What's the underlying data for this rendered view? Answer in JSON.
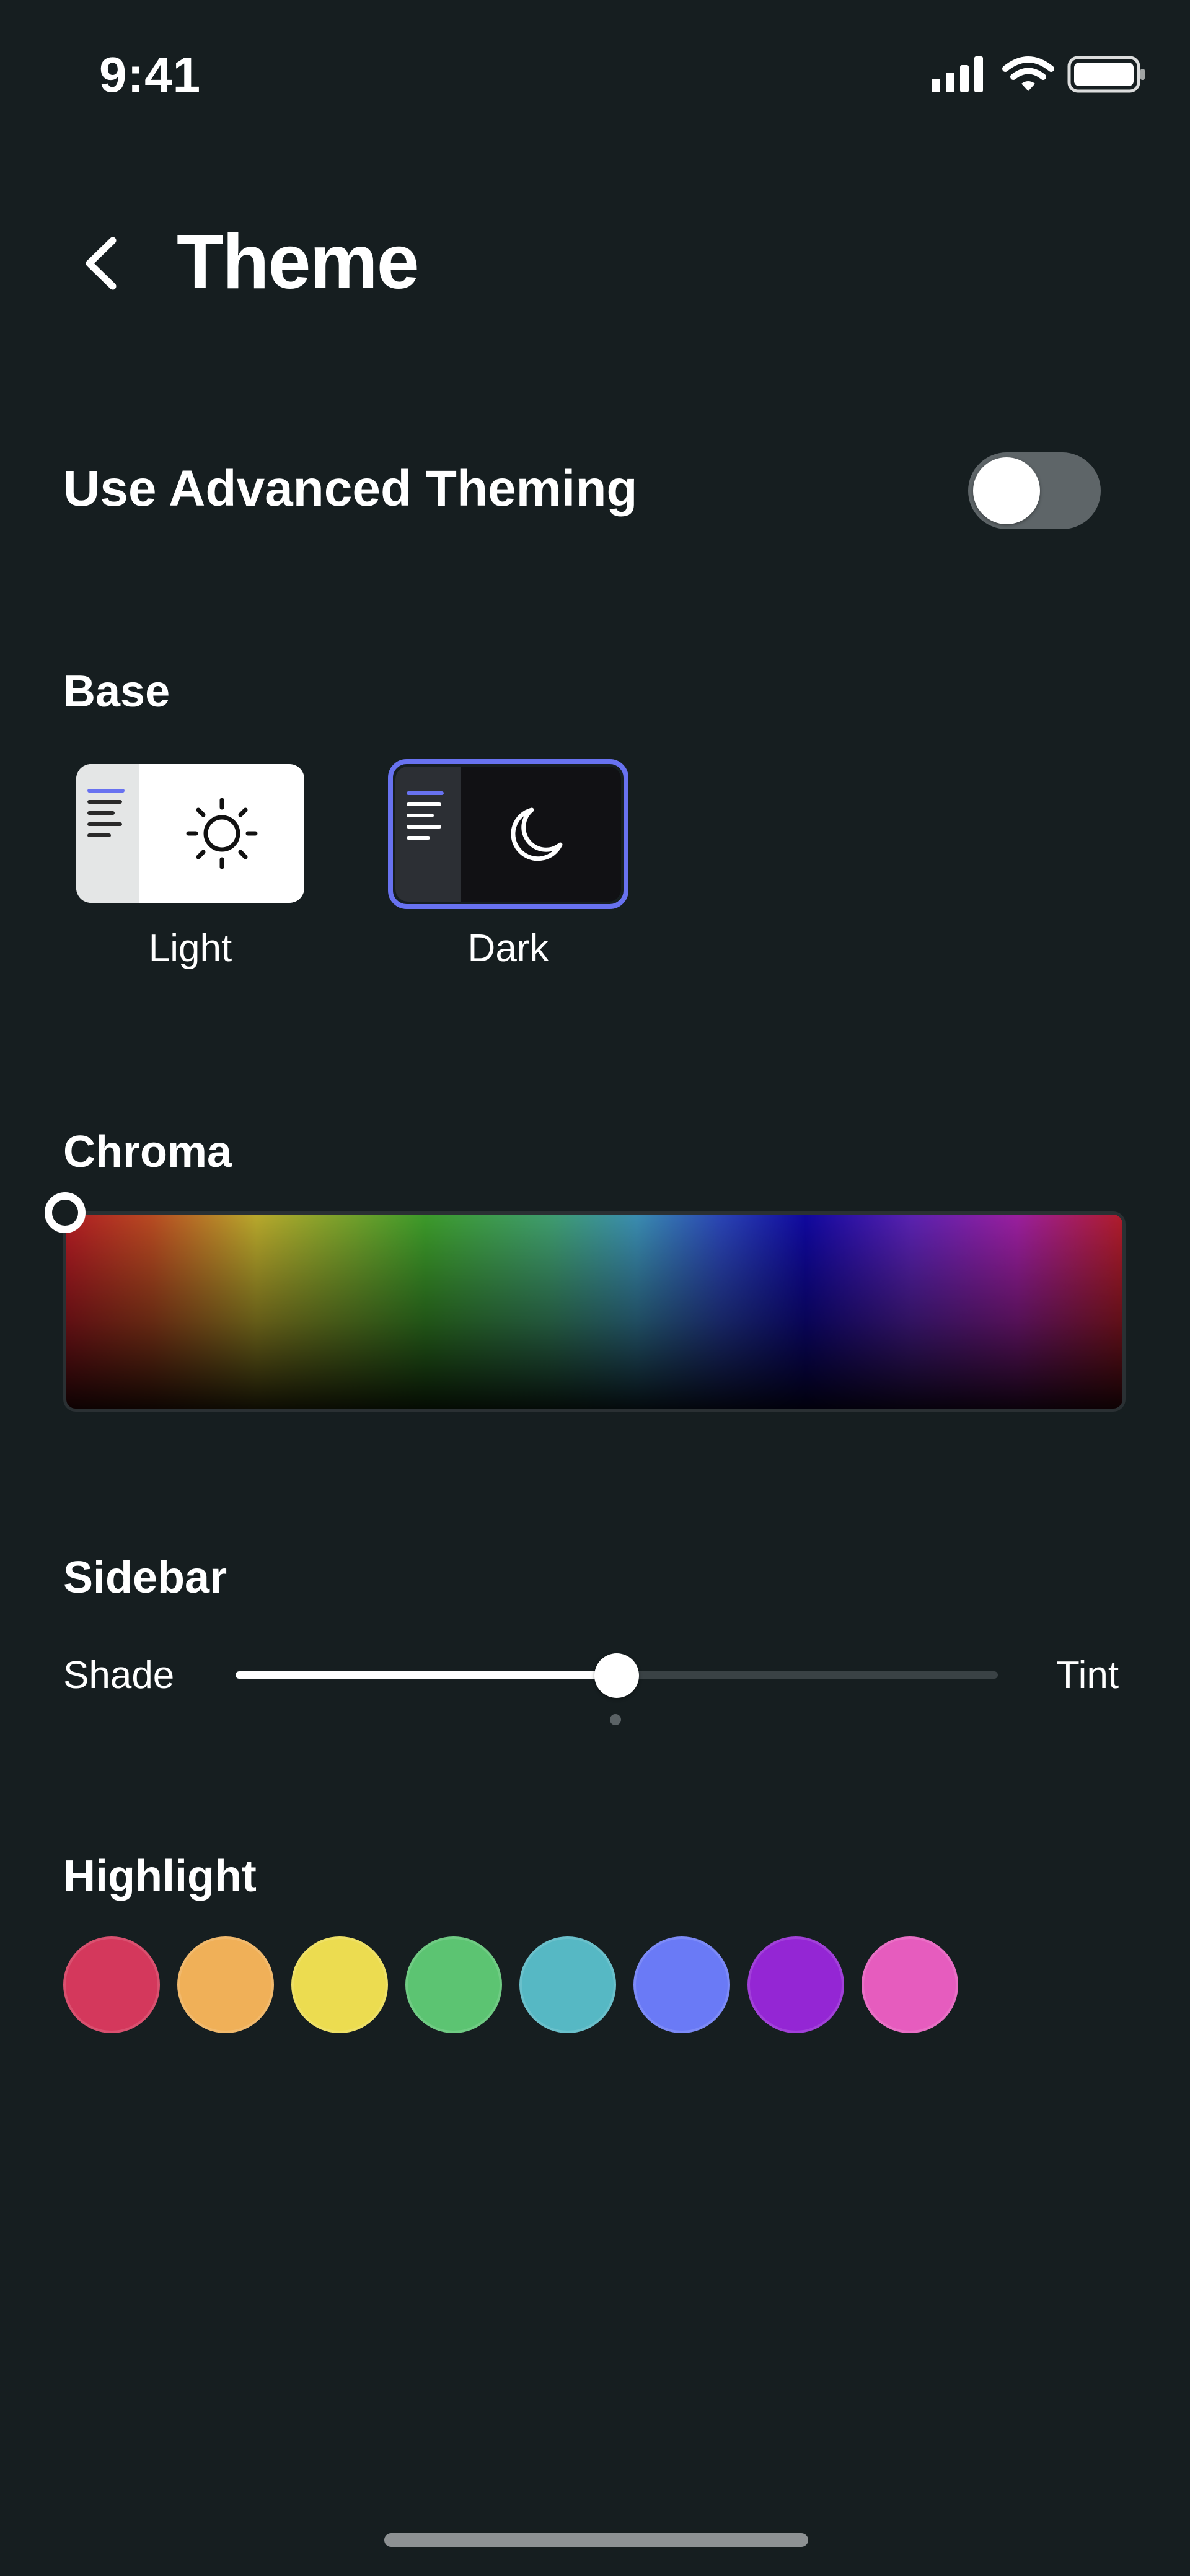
{
  "status_bar": {
    "time": "9:41"
  },
  "header": {
    "title": "Theme"
  },
  "advanced": {
    "label": "Use Advanced Theming",
    "enabled": false
  },
  "base": {
    "title": "Base",
    "options": [
      {
        "label": "Light",
        "selected": false
      },
      {
        "label": "Dark",
        "selected": true
      }
    ]
  },
  "chroma": {
    "title": "Chroma"
  },
  "sidebar": {
    "title": "Sidebar",
    "left_label": "Shade",
    "right_label": "Tint",
    "value_fraction": 0.5
  },
  "highlight": {
    "title": "Highlight",
    "colors": [
      "#d4385c",
      "#f0b058",
      "#ecdc50",
      "#5cc472",
      "#56b8c4",
      "#6a7af6",
      "#9426d4",
      "#e65cbe"
    ]
  },
  "colors": {
    "accent": "#6872f0",
    "background": "#161e20"
  }
}
